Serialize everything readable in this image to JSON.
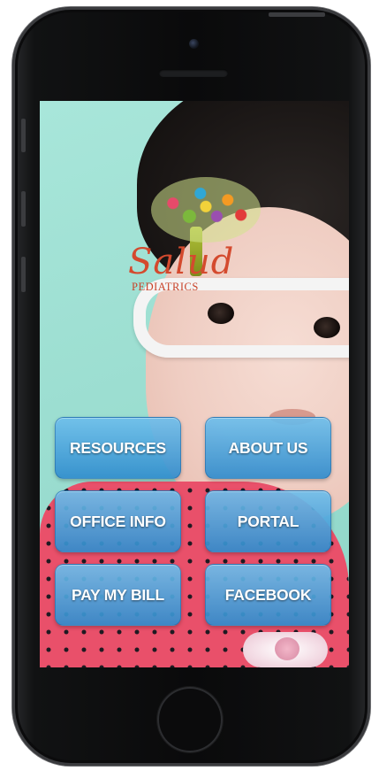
{
  "logo": {
    "script_text": "Salud",
    "subtitle": "PEDIATRICS"
  },
  "menu": {
    "resources_label": "RESOURCES",
    "about_label": "ABOUT US",
    "office_label": "OFFICE INFO",
    "portal_label": "PORTAL",
    "pay_label": "PAY MY BILL",
    "facebook_label": "FACEBOOK"
  },
  "colors": {
    "button_top": "#6ebeeb",
    "button_bottom": "#308ccd",
    "background": "#a8e6da",
    "logo_text": "#d44a2e"
  }
}
